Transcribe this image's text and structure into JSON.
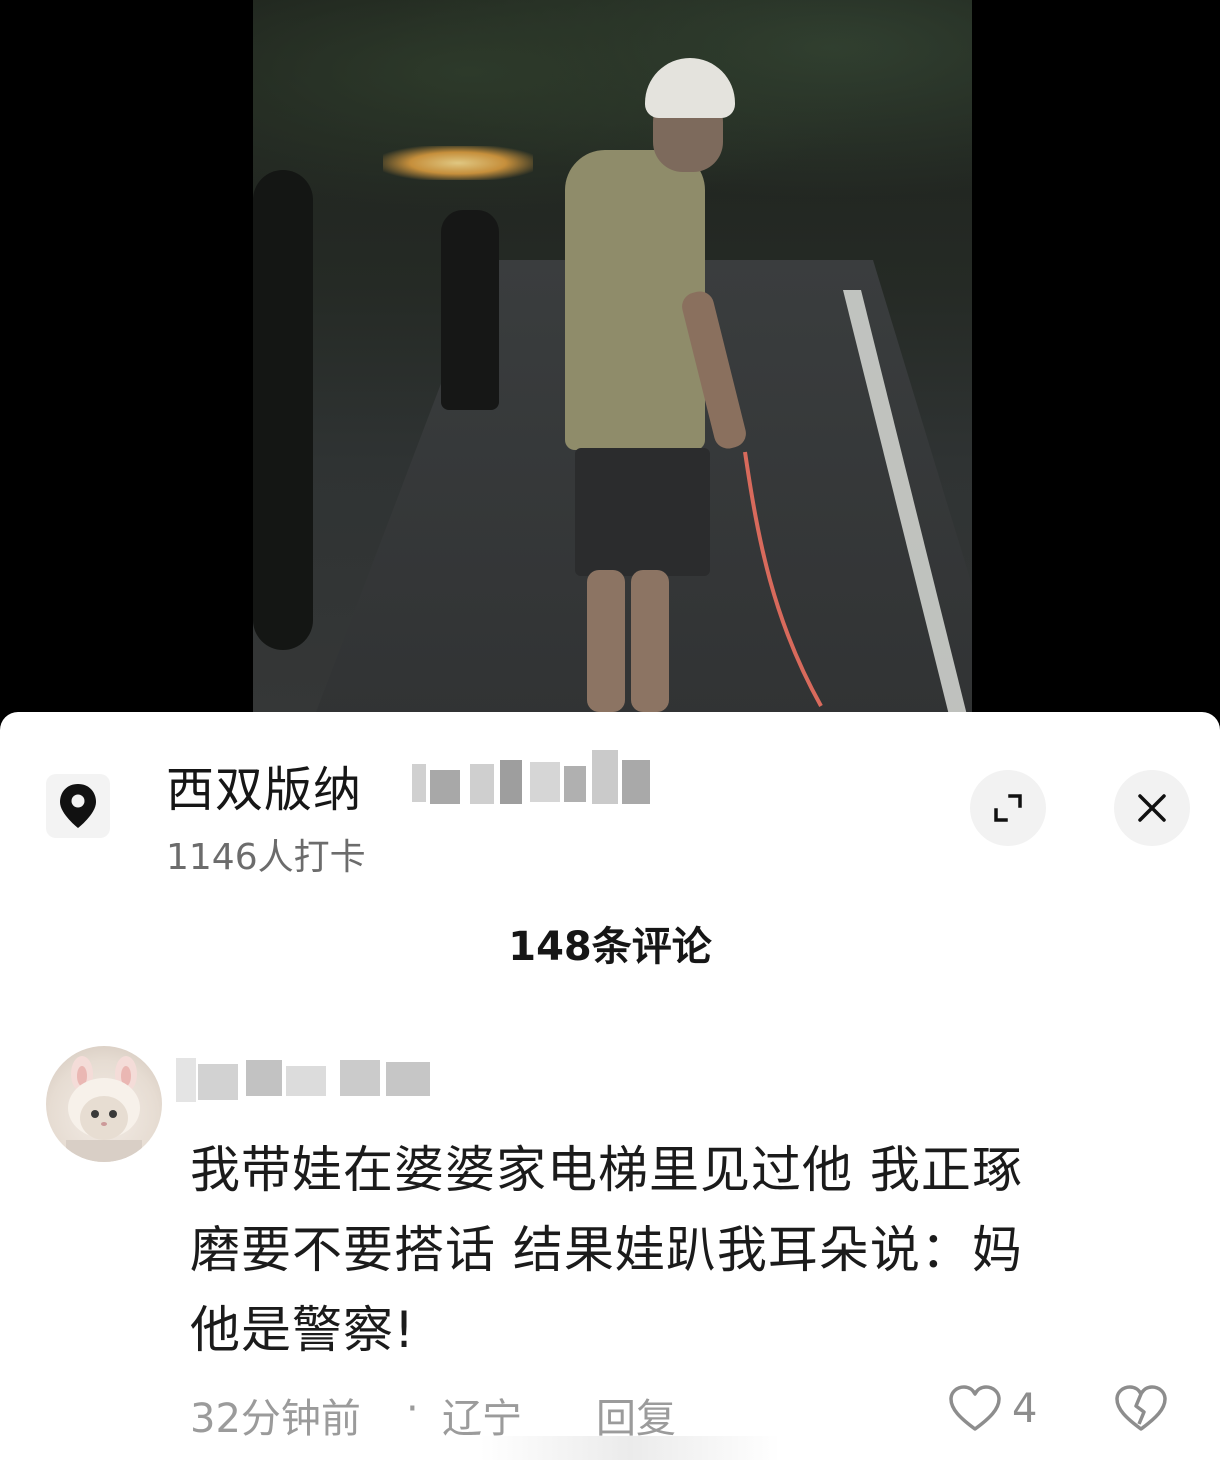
{
  "location": {
    "name": "西双版纳",
    "checkins": "1146人打卡"
  },
  "comments_header": "148条评论",
  "comment": {
    "text_line1": "我带娃在婆婆家电梯里见过他  我正琢",
    "text_line2": "磨要不要搭话 结果娃趴我耳朵说：妈",
    "text_line3": "他是警察!",
    "time": "32分钟前",
    "separator": "·",
    "region": "辽宁",
    "reply_label": "回复",
    "likes": "4"
  },
  "colors": {
    "sheet_bg": "#ffffff",
    "text_primary": "#161616",
    "text_secondary": "#6c6c6c",
    "text_meta": "#9b9b9b",
    "button_bg": "#f2f2f2"
  },
  "icons": {
    "location": "location-pin-icon",
    "expand": "expand-icon",
    "close": "close-icon",
    "like": "heart-icon",
    "dislike": "broken-heart-icon"
  }
}
